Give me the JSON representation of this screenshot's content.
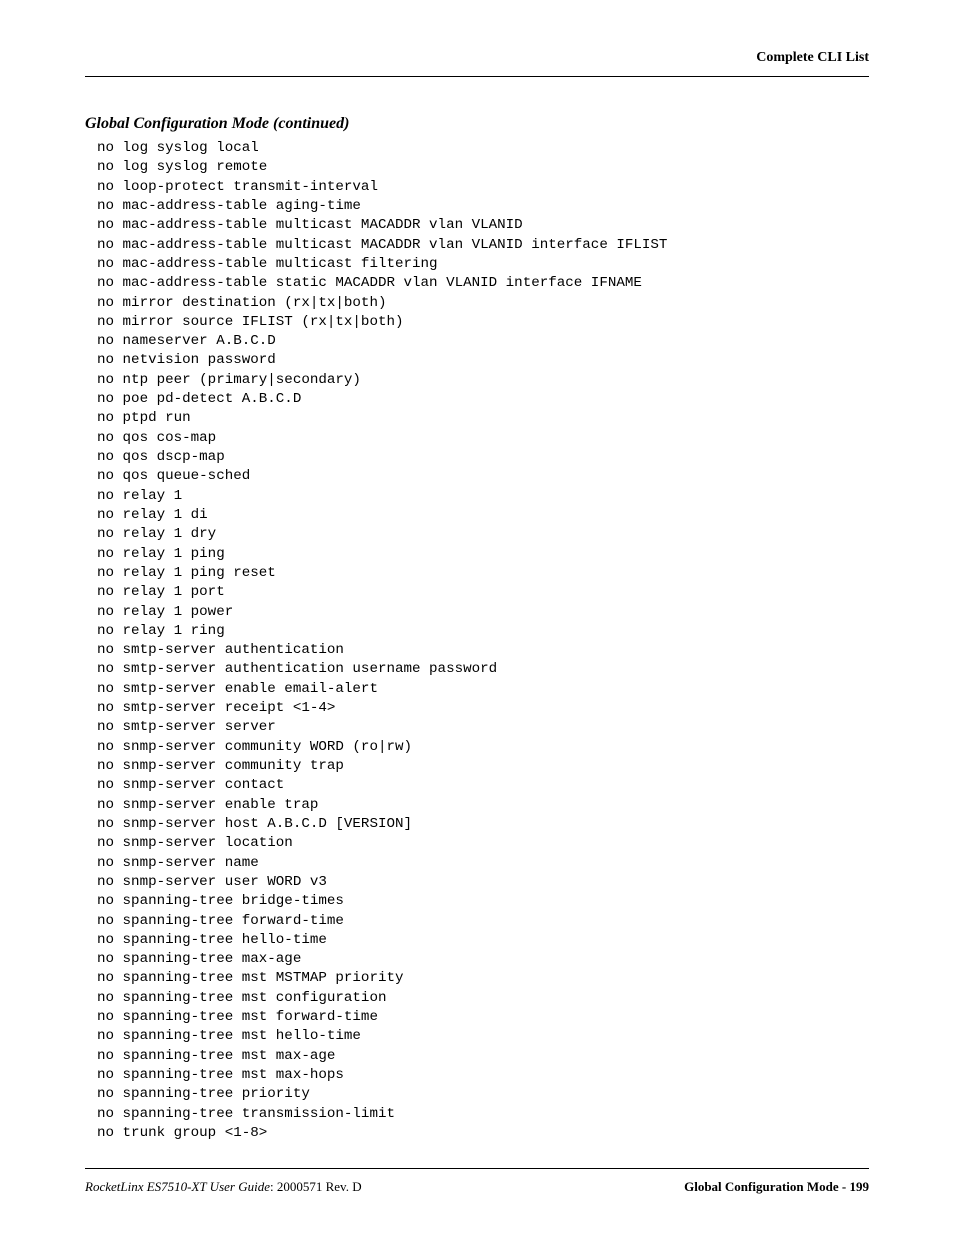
{
  "header": {
    "title": "Complete CLI List"
  },
  "section": {
    "title": "Global Configuration Mode (continued)"
  },
  "cli_lines": [
    "no log syslog local",
    "no log syslog remote",
    "no loop-protect transmit-interval",
    "no mac-address-table aging-time",
    "no mac-address-table multicast MACADDR vlan VLANID",
    "no mac-address-table multicast MACADDR vlan VLANID interface IFLIST",
    "no mac-address-table multicast filtering",
    "no mac-address-table static MACADDR vlan VLANID interface IFNAME",
    "no mirror destination (rx|tx|both)",
    "no mirror source IFLIST (rx|tx|both)",
    "no nameserver A.B.C.D",
    "no netvision password",
    "no ntp peer (primary|secondary)",
    "no poe pd-detect A.B.C.D",
    "no ptpd run",
    "no qos cos-map",
    "no qos dscp-map",
    "no qos queue-sched",
    "no relay 1",
    "no relay 1 di",
    "no relay 1 dry",
    "no relay 1 ping",
    "no relay 1 ping reset",
    "no relay 1 port",
    "no relay 1 power",
    "no relay 1 ring",
    "no smtp-server authentication",
    "no smtp-server authentication username password",
    "no smtp-server enable email-alert",
    "no smtp-server receipt <1-4>",
    "no smtp-server server",
    "no snmp-server community WORD (ro|rw)",
    "no snmp-server community trap",
    "no snmp-server contact",
    "no snmp-server enable trap",
    "no snmp-server host A.B.C.D [VERSION]",
    "no snmp-server location",
    "no snmp-server name",
    "no snmp-server user WORD v3",
    "no spanning-tree bridge-times",
    "no spanning-tree forward-time",
    "no spanning-tree hello-time",
    "no spanning-tree max-age",
    "no spanning-tree mst MSTMAP priority",
    "no spanning-tree mst configuration",
    "no spanning-tree mst forward-time",
    "no spanning-tree mst hello-time",
    "no spanning-tree mst max-age",
    "no spanning-tree mst max-hops",
    "no spanning-tree priority",
    "no spanning-tree transmission-limit",
    "no trunk group <1-8>"
  ],
  "footer": {
    "product": "RocketLinx ES7510-XT  User Guide",
    "doc_id": ": 2000571 Rev. D",
    "right": "Global Configuration Mode - 199"
  }
}
